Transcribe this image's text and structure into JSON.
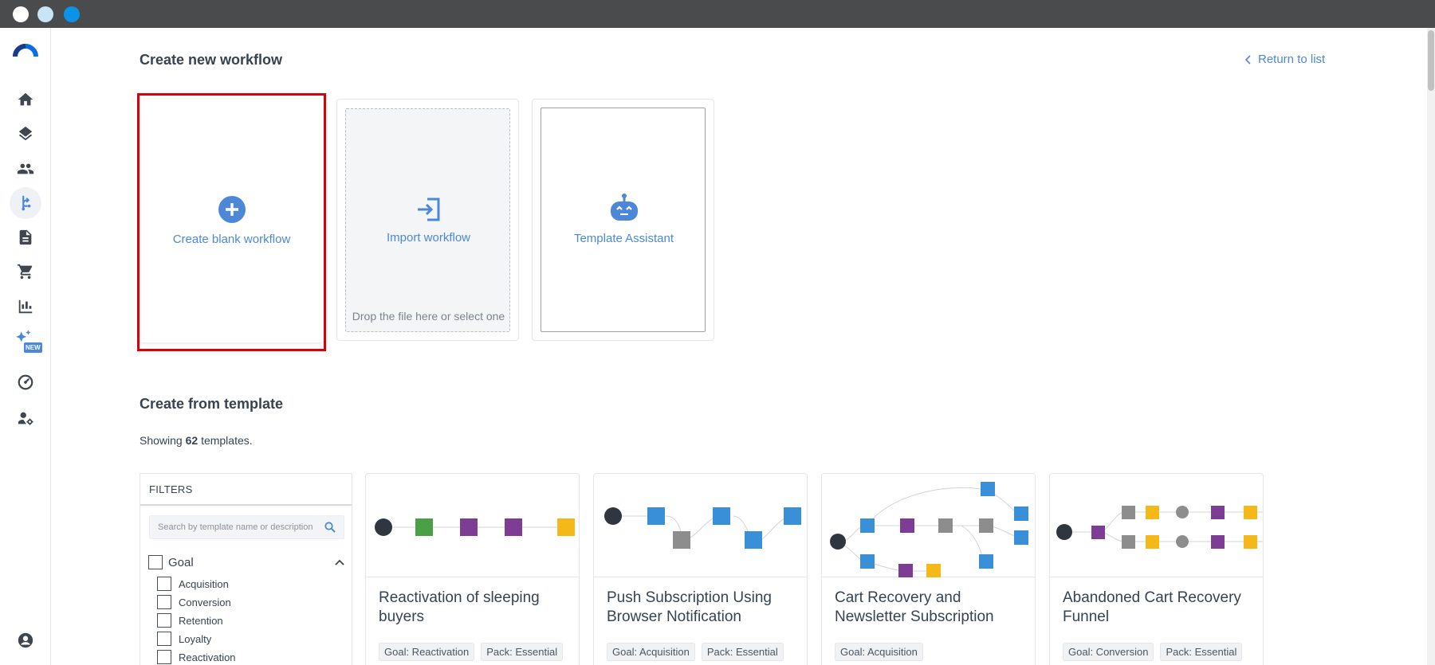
{
  "window": {
    "buttons": [
      "close",
      "minimize",
      "zoom"
    ]
  },
  "sidebar": {
    "logo": "brand-logo",
    "items": [
      {
        "icon": "home-icon"
      },
      {
        "icon": "layers-icon"
      },
      {
        "icon": "people-icon"
      },
      {
        "icon": "workflow-icon",
        "active": true
      },
      {
        "icon": "document-icon"
      },
      {
        "icon": "cart-icon"
      },
      {
        "icon": "bar-chart-icon"
      },
      {
        "icon": "sparkles-icon",
        "badge": "NEW"
      },
      {
        "icon": "gauge-icon"
      },
      {
        "icon": "user-settings-icon"
      },
      {
        "icon": "account-icon"
      }
    ]
  },
  "header": {
    "title": "Create new workflow",
    "return_link": "Return to list"
  },
  "create_options": {
    "blank": {
      "label": "Create blank workflow",
      "icon": "plus-circle-icon"
    },
    "import": {
      "label": "Import workflow",
      "drop_hint": "Drop the file here or select one",
      "icon": "import-icon"
    },
    "assistant": {
      "label": "Template Assistant",
      "icon": "robot-icon"
    }
  },
  "templates": {
    "title": "Create from template",
    "showing_prefix": "Showing",
    "count": "62",
    "showing_suffix": "templates.",
    "filters": {
      "header": "FILTERS",
      "search_placeholder": "Search by template name or description",
      "goal_group": {
        "label": "Goal",
        "options": [
          "Acquisition",
          "Conversion",
          "Retention",
          "Loyalty",
          "Reactivation"
        ]
      }
    },
    "cards": [
      {
        "name": "Reactivation of sleeping buyers",
        "tags": [
          "Goal: Reactivation",
          "Pack: Essential"
        ]
      },
      {
        "name": "Push Subscription Using Browser Notification",
        "tags": [
          "Goal: Acquisition",
          "Pack: Essential"
        ]
      },
      {
        "name": "Cart Recovery and Newsletter Subscription",
        "tags": [
          "Goal: Acquisition"
        ]
      },
      {
        "name": "Abandoned Cart Recovery Funnel",
        "tags": [
          "Goal: Conversion",
          "Pack: Essential"
        ]
      }
    ]
  },
  "colors": {
    "accent": "#4d88d8",
    "selection": "#d9000d",
    "node_blue": "#3a8fd9",
    "node_purple": "#7e3d95",
    "node_green": "#4ba046",
    "node_yellow": "#f4b919",
    "node_gray": "#8d8d8d",
    "node_dark": "#2f3640"
  }
}
